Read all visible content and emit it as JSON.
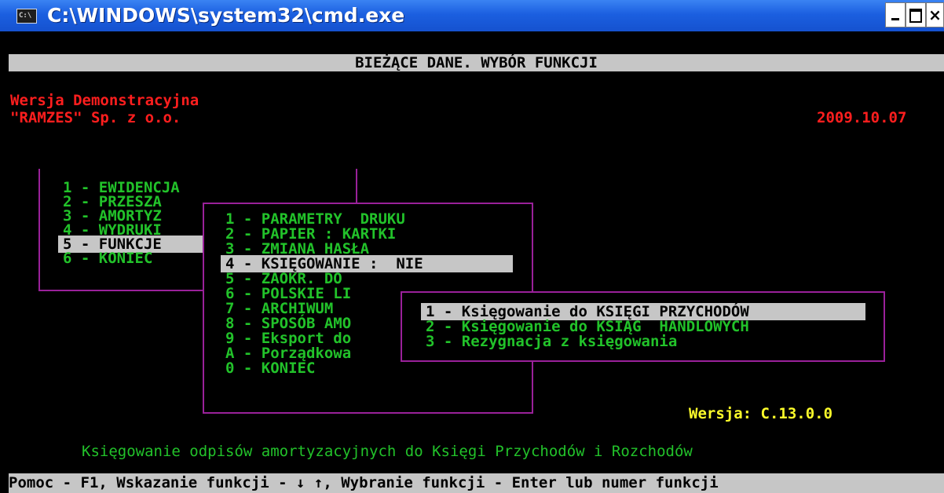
{
  "window": {
    "title": "C:\\WINDOWS\\system32\\cmd.exe",
    "icon_label": "C:\\",
    "minimize_glyph": "-",
    "close_glyph": "×"
  },
  "header": "BIEŻĄCE DANE. WYBÓR FUNKCJI",
  "company": {
    "version_line": "Wersja Demonstracyjna",
    "name": "\"RAMZES\" Sp. z o.o.",
    "date": "2009.10.07"
  },
  "main_menu": {
    "items": [
      {
        "label": "1 - EWIDENCJA",
        "selected": false
      },
      {
        "label": "2 - PRZESZA",
        "selected": false
      },
      {
        "label": "3 - AMORTYZ",
        "selected": false
      },
      {
        "label": "4 - WYDRUKI",
        "selected": false
      },
      {
        "label": "5 - FUNKCJE",
        "selected": true
      },
      {
        "label": "6 - KONIEC",
        "selected": false
      }
    ]
  },
  "functions_menu": {
    "items": [
      {
        "label": "1 - PARAMETRY  DRUKU",
        "selected": false
      },
      {
        "label": "2 - PAPIER : KARTKI",
        "selected": false
      },
      {
        "label": "3 - ZMIANA HASŁA",
        "selected": false
      },
      {
        "label": "4 - KSIĘGOWANIE :  NIE",
        "selected": true
      },
      {
        "label": "5 - ZAOKR. DO",
        "selected": false
      },
      {
        "label": "6 - POLSKIE LI",
        "selected": false
      },
      {
        "label": "7 - ARCHIWUM",
        "selected": false
      },
      {
        "label": "8 - SPOSÓB AMO",
        "selected": false
      },
      {
        "label": "9 - Eksport do",
        "selected": false
      },
      {
        "label": "A - Porządkowa",
        "selected": false
      },
      {
        "label": "0 - KONIEC",
        "selected": false
      }
    ]
  },
  "booking_menu": {
    "items": [
      {
        "label": "1 - Księgowanie do KSIĘGI PRZYCHODÓW",
        "selected": true
      },
      {
        "label": "2 - Księgowanie do KSIĄG  HANDLOWYCH",
        "selected": false
      },
      {
        "label": "3 - Rezygnacja z księgowania",
        "selected": false
      }
    ]
  },
  "version_info": "Wersja: C.13.0.0",
  "description": "Księgowanie odpisów amortyzacyjnych do Księgi Przychodów i Rozchodów",
  "help_line": "Pomoc - F1, Wskazanie funkcji - ↓ ↑, Wybranie funkcji - Enter lub numer funkcji",
  "colors": {
    "title_bar": "#1b5fe0",
    "menu_border": "#9a219a",
    "highlight": "#c6c6c6",
    "menu_text": "#22c22a",
    "company_text": "#ff1e1e",
    "version_text": "#ffff2a"
  }
}
